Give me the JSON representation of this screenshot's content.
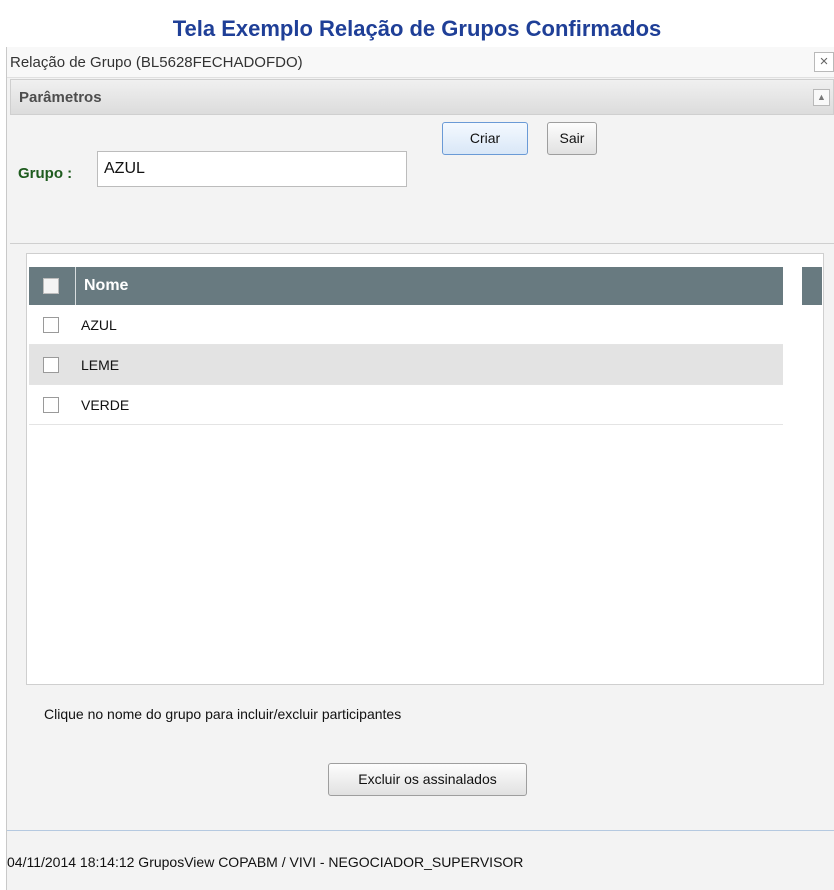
{
  "document_title": "Tela Exemplo Relação de Grupos Confirmados",
  "window": {
    "title": "Relação de Grupo (BL5628FECHADOFDO)",
    "close_glyph": "×"
  },
  "parameters": {
    "header_label": "Parâmetros",
    "collapse_glyph": "▲",
    "grupo_label": "Grupo :",
    "grupo_value": "AZUL",
    "criar_label": "Criar",
    "sair_label": "Sair"
  },
  "grid": {
    "column_header": "Nome",
    "rows": [
      {
        "name": "AZUL",
        "checked": false
      },
      {
        "name": "LEME",
        "checked": false
      },
      {
        "name": "VERDE",
        "checked": false
      }
    ]
  },
  "hint_text": "Clique no nome do grupo para incluir/excluir participantes",
  "delete_button_label": "Excluir os assinalados",
  "status_bar": "04/11/2014 18:14:12 GruposView COPABM / VIVI - NEGOCIADOR_SUPERVISOR",
  "colors": {
    "title_blue": "#1f3f97",
    "grid_header": "#687a80",
    "grupo_label_green": "#1e5b1e"
  },
  "icons": {
    "close": "close-icon",
    "collapse": "chevron-up-icon"
  }
}
